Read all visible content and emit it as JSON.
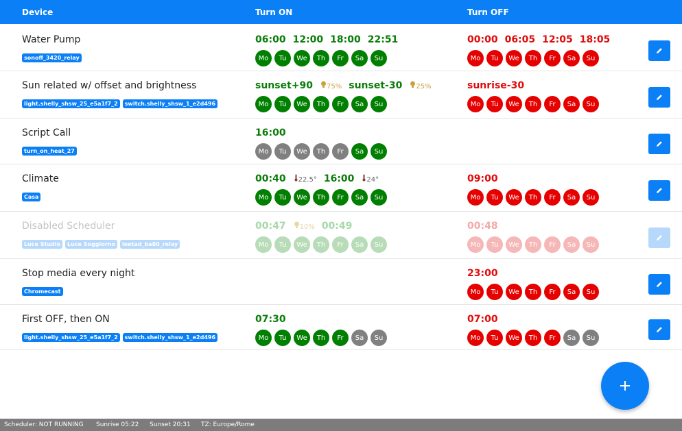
{
  "header": {
    "device": "Device",
    "turn_on": "Turn ON",
    "turn_off": "Turn OFF"
  },
  "day_labels": [
    "Mo",
    "Tu",
    "We",
    "Th",
    "Fr",
    "Sa",
    "Su"
  ],
  "icons": {
    "edit": "pencil-icon",
    "add": "plus-icon",
    "brightness": "bulb-icon",
    "temperature": "thermometer-icon"
  },
  "colors": {
    "accent": "#0b7ff5",
    "on": "#007f00",
    "off": "#e60000",
    "inactive": "#808080"
  },
  "rows": [
    {
      "name": "Water Pump",
      "tags": [
        "sonoff_3420_relay"
      ],
      "on_times": [
        {
          "time": "06:00"
        },
        {
          "time": "12:00"
        },
        {
          "time": "18:00"
        },
        {
          "time": "22:51"
        }
      ],
      "on_days": [
        true,
        true,
        true,
        true,
        true,
        true,
        true
      ],
      "off_times": [
        {
          "time": "00:00"
        },
        {
          "time": "06:05"
        },
        {
          "time": "12:05"
        },
        {
          "time": "18:05"
        }
      ],
      "off_days": [
        true,
        true,
        true,
        true,
        true,
        true,
        true
      ]
    },
    {
      "name": "Sun related w/ offset and brightness",
      "tags": [
        "light.shelly_shsw_25_e5a1f7_2",
        "switch.shelly_shsw_1_e2d496"
      ],
      "on_times": [
        {
          "time": "sunset+90",
          "meta": "75%",
          "meta_type": "brightness"
        },
        {
          "time": "sunset-30",
          "meta": "25%",
          "meta_type": "brightness"
        }
      ],
      "on_days": [
        true,
        true,
        true,
        true,
        true,
        true,
        true
      ],
      "off_times": [
        {
          "time": "sunrise-30"
        }
      ],
      "off_days": [
        true,
        true,
        true,
        true,
        true,
        true,
        true
      ]
    },
    {
      "name": "Script Call",
      "tags": [
        "turn_on_heat_27"
      ],
      "on_times": [
        {
          "time": "16:00"
        }
      ],
      "on_days": [
        false,
        false,
        false,
        false,
        false,
        true,
        true
      ],
      "off_times": [],
      "off_days": []
    },
    {
      "name": "Climate",
      "tags": [
        "Casa"
      ],
      "on_times": [
        {
          "time": "00:40",
          "meta": "22.5°",
          "meta_type": "temperature"
        },
        {
          "time": "16:00",
          "meta": "24°",
          "meta_type": "temperature"
        }
      ],
      "on_days": [
        true,
        true,
        true,
        true,
        true,
        true,
        true
      ],
      "off_times": [
        {
          "time": "09:00"
        }
      ],
      "off_days": [
        true,
        true,
        true,
        true,
        true,
        true,
        true
      ]
    },
    {
      "name": "Disabled Scheduler",
      "disabled": true,
      "tags": [
        "Luce Studio",
        "Luce Soggiorno",
        "loetad_ba80_relay"
      ],
      "on_times": [
        {
          "time": "00:47",
          "meta": "10%",
          "meta_type": "brightness"
        },
        {
          "time": "00:49"
        }
      ],
      "on_days": [
        true,
        true,
        true,
        true,
        true,
        true,
        true
      ],
      "off_times": [
        {
          "time": "00:48"
        }
      ],
      "off_days": [
        true,
        true,
        true,
        true,
        true,
        true,
        true
      ]
    },
    {
      "name": "Stop media every night",
      "tags": [
        "Chromecast"
      ],
      "on_times": [],
      "on_days": [],
      "off_times": [
        {
          "time": "23:00"
        }
      ],
      "off_days": [
        true,
        true,
        true,
        true,
        true,
        true,
        true
      ]
    },
    {
      "name": "First OFF, then ON",
      "tags": [
        "light.shelly_shsw_25_e5a1f7_2",
        "switch.shelly_shsw_1_e2d496"
      ],
      "on_times": [
        {
          "time": "07:30"
        }
      ],
      "on_days": [
        true,
        true,
        true,
        true,
        true,
        false,
        false
      ],
      "off_times": [
        {
          "time": "07:00"
        }
      ],
      "off_days": [
        true,
        true,
        true,
        true,
        true,
        false,
        false
      ]
    }
  ],
  "footer": {
    "status": "Scheduler: NOT RUNNING",
    "sunrise": "Sunrise 05:22",
    "sunset": "Sunset 20:31",
    "tz": "TZ: Europe/Rome"
  }
}
